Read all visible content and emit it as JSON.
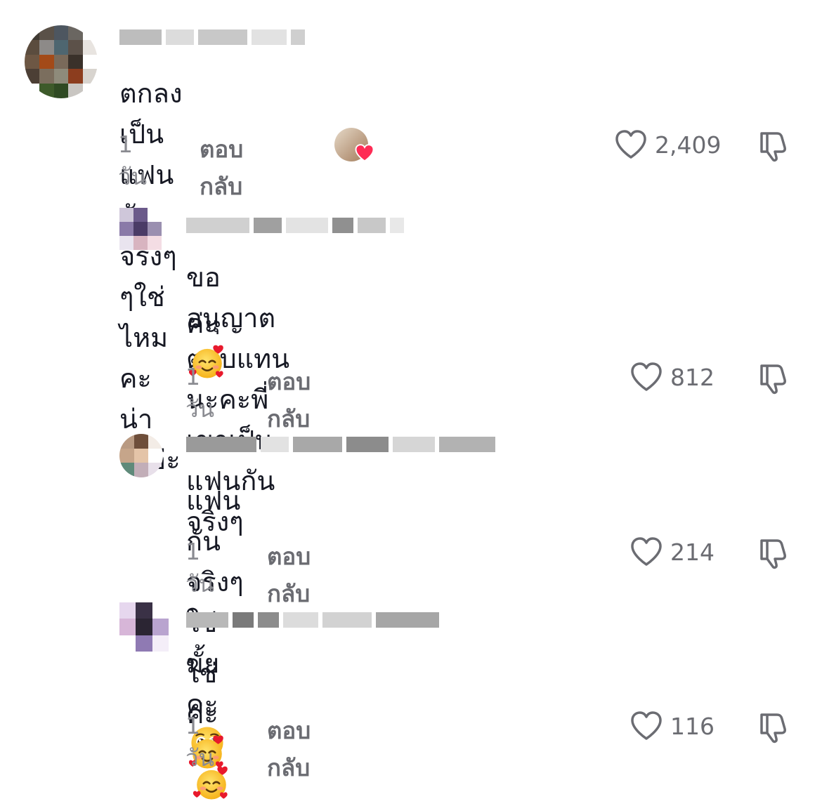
{
  "comments": [
    {
      "text": "ตกลงเป็นแฟนกันจริงๆๆใช่ไหมคะน่ารักอ่ะ",
      "time": "1 วัน",
      "reply_label": "ตอบกลับ",
      "likes": "2,409",
      "creator_liked": true
    },
    {
      "text": "ขออนุญาตตอบแทนนะคะพี่เขาเป็นแฟนกันจริงๆ",
      "text_line2": "ค่ะ",
      "time": "1 วัน",
      "reply_label": "ตอบกลับ",
      "likes": "812"
    },
    {
      "text": "แฟนกันจริงๆใช่มั้ยคะ",
      "time": "1 วัน",
      "reply_label": "ตอบกลับ",
      "likes": "214"
    },
    {
      "text": "ใช่ค่ะ",
      "time": "1 วัน",
      "reply_label": "ตอบกลับ",
      "likes": "116"
    }
  ],
  "icons": {
    "like": "heart-outline-icon",
    "dislike": "thumbs-down-icon",
    "creator_heart": "heart-filled-icon"
  },
  "colors": {
    "text": "#161823",
    "muted": "#8a8b91",
    "heart_red": "#fe2c55"
  }
}
